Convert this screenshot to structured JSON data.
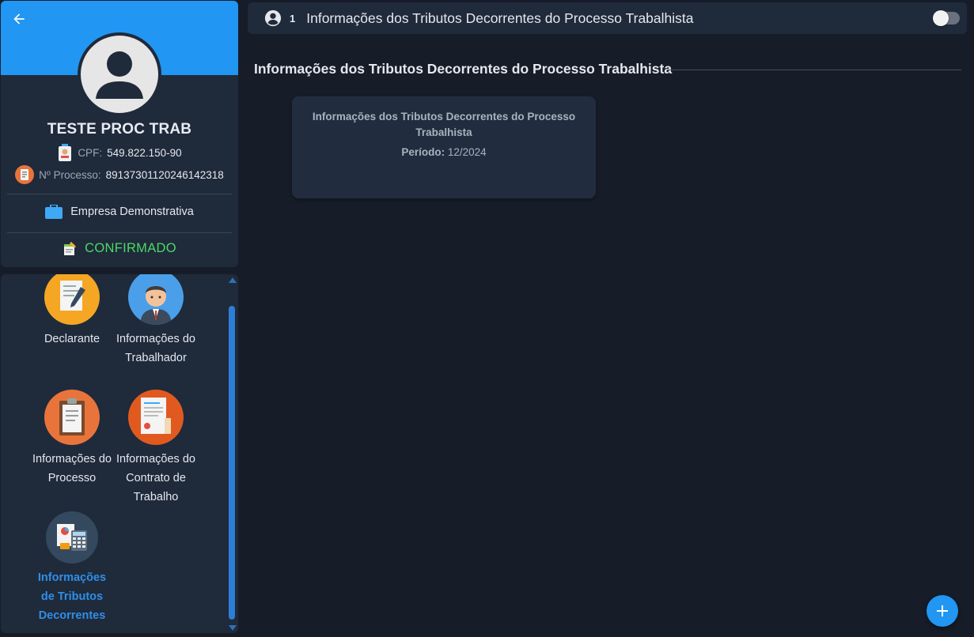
{
  "profile": {
    "name": "TESTE PROC TRAB",
    "cpf_label": "CPF:",
    "cpf_value": "549.822.150-90",
    "process_label": "Nº Processo:",
    "process_value": "89137301120246142318",
    "company": "Empresa Demonstrativa",
    "status": "CONFIRMADO",
    "colors": {
      "banner": "#2196f3",
      "status": "#4cd964"
    }
  },
  "menu": {
    "items": [
      {
        "label": "Declarante",
        "icon": "document-pen-icon"
      },
      {
        "label": "Informações do Trabalhador",
        "icon": "worker-icon"
      },
      {
        "label": "Informações do Processo",
        "icon": "clipboard-icon"
      },
      {
        "label": "Informações do Contrato de Trabalho",
        "icon": "contract-icon"
      },
      {
        "label": "Informações de Tributos Decorrentes",
        "icon": "calculator-icon",
        "active": true
      }
    ]
  },
  "top_bar": {
    "number": "1",
    "title": "Informações dos Tributos Decorrentes do Processo Trabalhista",
    "toggle_on": false
  },
  "section": {
    "title": "Informações dos Tributos Decorrentes do Processo Trabalhista"
  },
  "record": {
    "title": "Informações dos Tributos Decorrentes do Processo Trabalhista",
    "period_label": "Período:",
    "period_value": "12/2024"
  },
  "fab": {
    "icon": "plus-icon",
    "color": "#2196f3"
  }
}
